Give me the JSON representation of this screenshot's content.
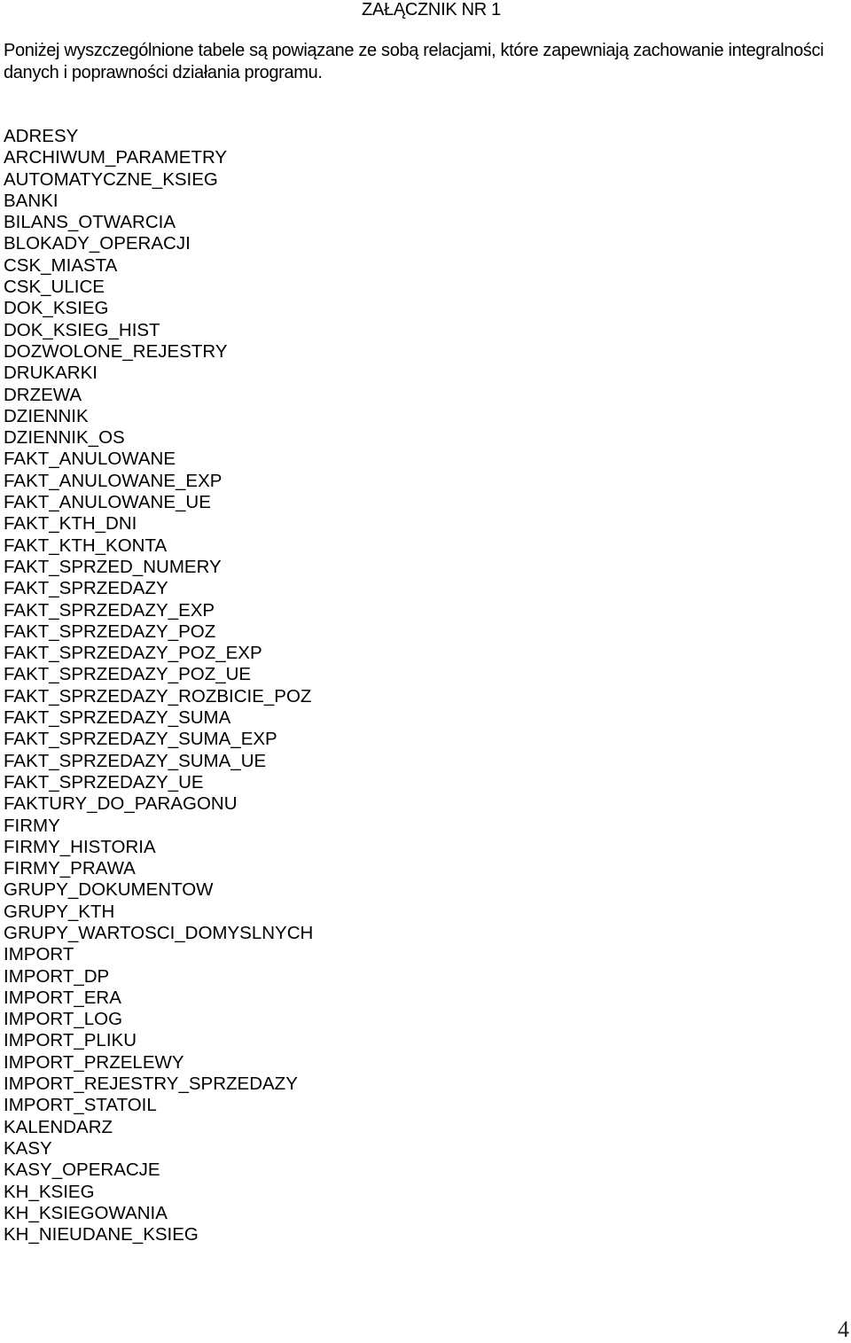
{
  "document": {
    "title": "ZAŁĄCZNIK NR 1",
    "intro": "Poniżej wyszczególnione tabele są powiązane ze sobą relacjami, które zapewniają zachowanie integralności danych i poprawności działania programu.",
    "tables": [
      "ADRESY",
      "ARCHIWUM_PARAMETRY",
      "AUTOMATYCZNE_KSIEG",
      "BANKI",
      "BILANS_OTWARCIA",
      "BLOKADY_OPERACJI",
      "CSK_MIASTA",
      "CSK_ULICE",
      "DOK_KSIEG",
      "DOK_KSIEG_HIST",
      "DOZWOLONE_REJESTRY",
      "DRUKARKI",
      "DRZEWA",
      "DZIENNIK",
      "DZIENNIK_OS",
      "FAKT_ANULOWANE",
      "FAKT_ANULOWANE_EXP",
      "FAKT_ANULOWANE_UE",
      "FAKT_KTH_DNI",
      "FAKT_KTH_KONTA",
      "FAKT_SPRZED_NUMERY",
      "FAKT_SPRZEDAZY",
      "FAKT_SPRZEDAZY_EXP",
      "FAKT_SPRZEDAZY_POZ",
      "FAKT_SPRZEDAZY_POZ_EXP",
      "FAKT_SPRZEDAZY_POZ_UE",
      "FAKT_SPRZEDAZY_ROZBICIE_POZ",
      "FAKT_SPRZEDAZY_SUMA",
      "FAKT_SPRZEDAZY_SUMA_EXP",
      "FAKT_SPRZEDAZY_SUMA_UE",
      "FAKT_SPRZEDAZY_UE",
      "FAKTURY_DO_PARAGONU",
      "FIRMY",
      "FIRMY_HISTORIA",
      "FIRMY_PRAWA",
      "GRUPY_DOKUMENTOW",
      "GRUPY_KTH",
      "GRUPY_WARTOSCI_DOMYSLNYCH",
      "IMPORT",
      "IMPORT_DP",
      "IMPORT_ERA",
      "IMPORT_LOG",
      "IMPORT_PLIKU",
      "IMPORT_PRZELEWY",
      "IMPORT_REJESTRY_SPRZEDAZY",
      "IMPORT_STATOIL",
      "KALENDARZ",
      "KASY",
      "KASY_OPERACJE",
      "KH_KSIEG",
      "KH_KSIEGOWANIA",
      "KH_NIEUDANE_KSIEG"
    ],
    "page_number": "4"
  }
}
